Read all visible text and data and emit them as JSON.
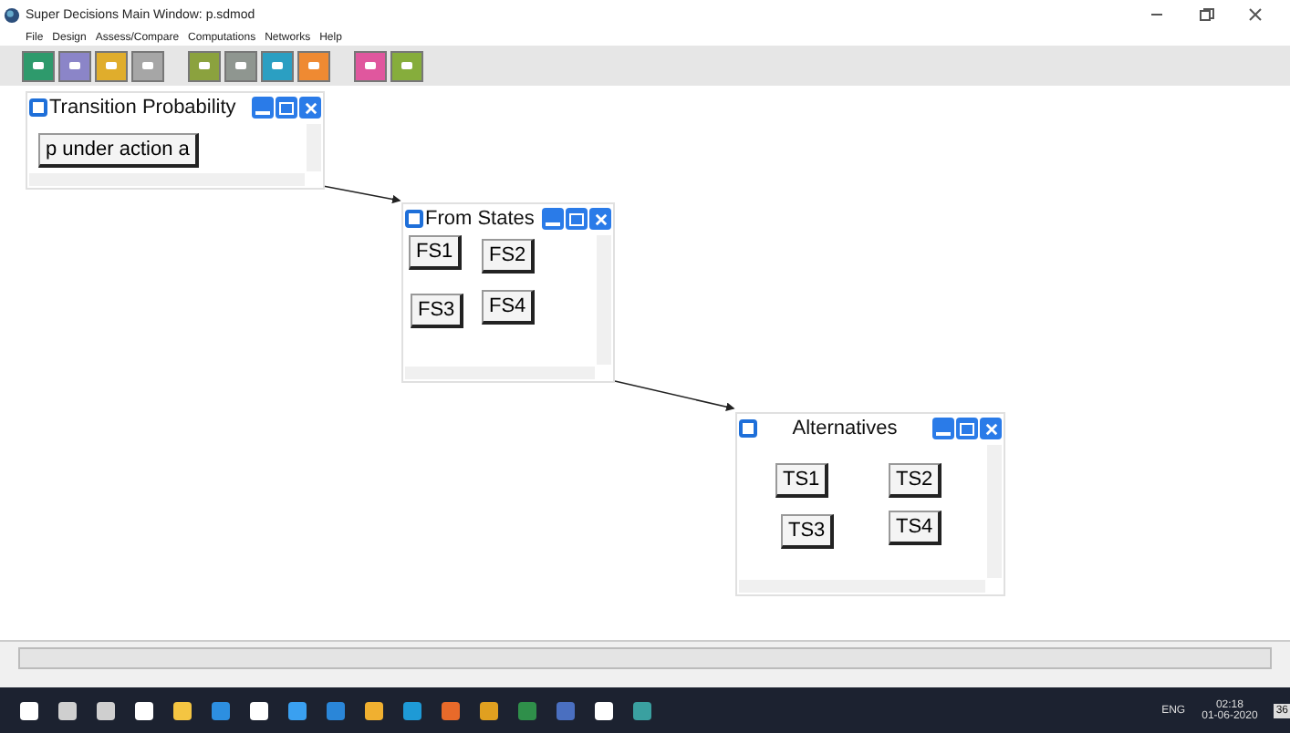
{
  "window": {
    "title": "Super Decisions Main Window: p.sdmod"
  },
  "menu": [
    "File",
    "Design",
    "Assess/Compare",
    "Computations",
    "Networks",
    "Help"
  ],
  "toolbar": [
    {
      "color": "#2e9a6c"
    },
    {
      "color": "#8b85c8"
    },
    {
      "color": "#e0ad2c"
    },
    {
      "color": "#a6a6a6"
    },
    {
      "color": "#8ba23e"
    },
    {
      "color": "#8f9690"
    },
    {
      "color": "#2b9fc2"
    },
    {
      "color": "#ef8a32"
    },
    {
      "color": "#e0579e"
    },
    {
      "color": "#86ad3c"
    }
  ],
  "clusters": [
    {
      "title": "Transition Probability",
      "nodes": [
        "p under action a"
      ]
    },
    {
      "title": "From States",
      "nodes": [
        "FS1",
        "FS2",
        "FS3",
        "FS4"
      ]
    },
    {
      "title": "Alternatives",
      "nodes": [
        "TS1",
        "TS2",
        "TS3",
        "TS4"
      ]
    }
  ],
  "taskbar": {
    "language": "ENG",
    "time": "02:18",
    "date": "01-06-2020",
    "badge": "36"
  }
}
